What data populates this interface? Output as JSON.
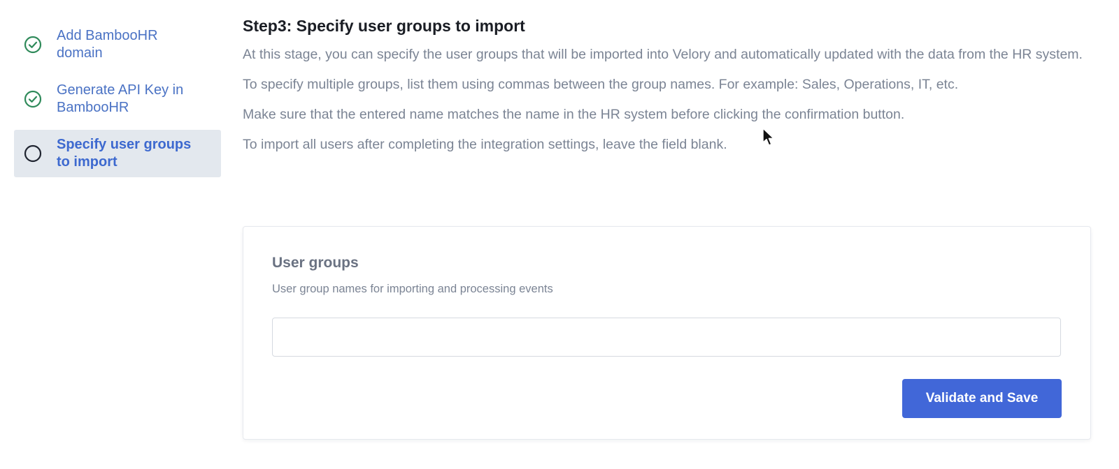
{
  "sidebar": {
    "steps": [
      {
        "label_line1": "Add BambooHR",
        "label_line2": "domain",
        "status": "completed",
        "icon": "check-circle-icon"
      },
      {
        "label_line1": "Generate API Key in",
        "label_line2": "BambooHR",
        "status": "completed",
        "icon": "check-circle-icon"
      },
      {
        "label_line1": "Specify user groups",
        "label_line2": "to import",
        "status": "current",
        "icon": "empty-circle-icon"
      }
    ]
  },
  "main": {
    "title": "Step3: Specify user groups to import",
    "paragraphs": [
      "At this stage, you can specify the user groups that will be imported into Velory and automatically updated with the data from the HR system.",
      "To specify multiple groups, list them using commas between the group names. For example: Sales, Operations, IT, etc.",
      "Make sure that the entered name matches the name in the HR system before clicking the confirmation button.",
      "To import all users after completing the integration settings, leave the field blank."
    ]
  },
  "form": {
    "field_label": "User groups",
    "field_help": "User group names for importing and processing events",
    "input_value": "",
    "submit_label": "Validate and Save"
  },
  "colors": {
    "accent": "#4167d8",
    "check_green": "#2f8a5a",
    "link_blue": "#4a72c4",
    "active_bg": "#e3e8ee"
  }
}
